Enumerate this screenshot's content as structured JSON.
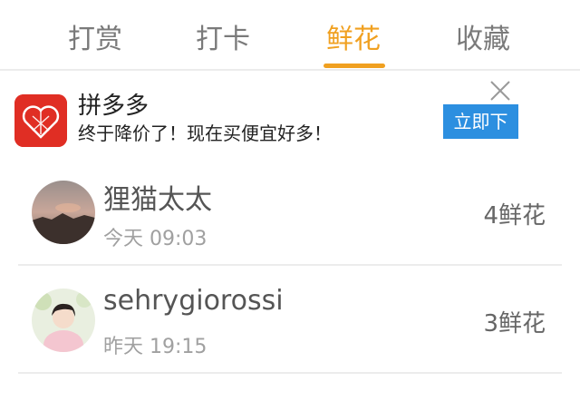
{
  "tabs": [
    {
      "label": "打赏",
      "active": false
    },
    {
      "label": "打卡",
      "active": false
    },
    {
      "label": "鲜花",
      "active": true
    },
    {
      "label": "收藏",
      "active": false
    }
  ],
  "colors": {
    "accent": "#f0a020",
    "ad_logo_bg": "#e02e24",
    "ad_button_bg": "#2c8fe0",
    "divider": "#ececec"
  },
  "ad": {
    "logo_icon": "pinduoduo-logo-icon",
    "title": "拼多多",
    "subtitle": "终于降价了！现在买便宜好多！",
    "button_label": "立即下",
    "close_icon": "close-icon"
  },
  "flowers": [
    {
      "name": "狸猫太太",
      "time": "今天 09:03",
      "count": "4鲜花"
    },
    {
      "name": "sehrygiorossi",
      "time": "昨天 19:15",
      "count": "3鲜花"
    }
  ]
}
